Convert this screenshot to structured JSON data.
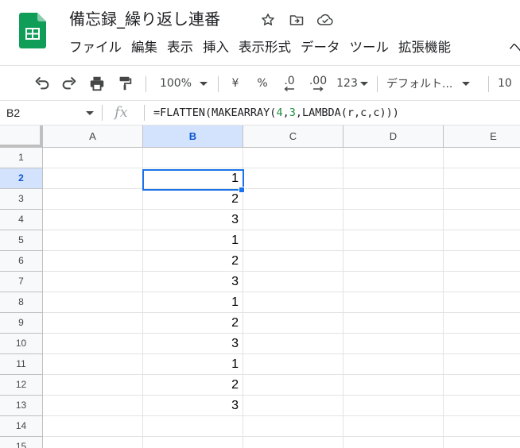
{
  "doc": {
    "title": "備忘録_繰り返し連番"
  },
  "menu": {
    "items": [
      "ファイル",
      "編集",
      "表示",
      "挿入",
      "表示形式",
      "データ",
      "ツール",
      "拡張機能"
    ],
    "tail": "ヘ"
  },
  "toolbar": {
    "zoom": "100%",
    "currency": "¥",
    "percent": "%",
    "decrease_decimal": ".0",
    "increase_decimal": ".00",
    "number_format": "123",
    "font": "デフォルト...",
    "font_size": "10"
  },
  "formula_bar": {
    "name_box": "B2",
    "fx": "fx",
    "formula_parts": [
      {
        "text": "=FLATTEN(MAKEARRAY(",
        "kind": "plain"
      },
      {
        "text": "4",
        "kind": "num"
      },
      {
        "text": ",",
        "kind": "plain"
      },
      {
        "text": "3",
        "kind": "num"
      },
      {
        "text": ",LAMBDA(r,c,c)))",
        "kind": "plain"
      }
    ]
  },
  "sheet": {
    "columns": [
      "A",
      "B",
      "C",
      "D",
      "E"
    ],
    "active_column": "B",
    "rows": [
      "1",
      "2",
      "3",
      "4",
      "5",
      "6",
      "7",
      "8",
      "9",
      "10",
      "11",
      "12",
      "13",
      "14",
      "15"
    ],
    "active_row": "2",
    "values_column": "B",
    "values": [
      "",
      "1",
      "2",
      "3",
      "1",
      "2",
      "3",
      "1",
      "2",
      "3",
      "1",
      "2",
      "3",
      "",
      ""
    ],
    "selected_cell": "B2"
  },
  "colors": {
    "accent": "#1a73e8",
    "header_active_bg": "#d3e3fd",
    "sheets_green": "#0f9d58",
    "formula_number": "#1e8e3e"
  }
}
